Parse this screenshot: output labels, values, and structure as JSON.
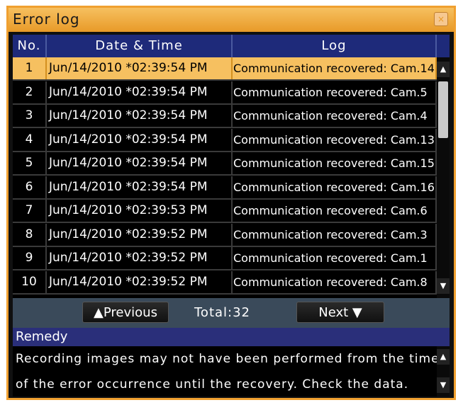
{
  "window": {
    "title": "Error log",
    "close_label": "×"
  },
  "table": {
    "headers": [
      "No.",
      "Date & Time",
      "Log"
    ],
    "rows": [
      {
        "no": "1",
        "datetime": "Jun/14/2010  *02:39:54 PM",
        "log": "Communication recovered: Cam.14",
        "selected": true
      },
      {
        "no": "2",
        "datetime": "Jun/14/2010  *02:39:54 PM",
        "log": "Communication recovered: Cam.5"
      },
      {
        "no": "3",
        "datetime": "Jun/14/2010  *02:39:54 PM",
        "log": "Communication recovered: Cam.4"
      },
      {
        "no": "4",
        "datetime": "Jun/14/2010  *02:39:54 PM",
        "log": "Communication recovered: Cam.13"
      },
      {
        "no": "5",
        "datetime": "Jun/14/2010  *02:39:54 PM",
        "log": "Communication recovered: Cam.15"
      },
      {
        "no": "6",
        "datetime": "Jun/14/2010  *02:39:54 PM",
        "log": "Communication recovered: Cam.16"
      },
      {
        "no": "7",
        "datetime": "Jun/14/2010  *02:39:53 PM",
        "log": "Communication recovered: Cam.6"
      },
      {
        "no": "8",
        "datetime": "Jun/14/2010  *02:39:52 PM",
        "log": "Communication recovered: Cam.3"
      },
      {
        "no": "9",
        "datetime": "Jun/14/2010  *02:39:52 PM",
        "log": "Communication recovered: Cam.1"
      },
      {
        "no": "10",
        "datetime": "Jun/14/2010  *02:39:52 PM",
        "log": "Communication recovered: Cam.8"
      }
    ],
    "scroll_up_icon": "▲",
    "scroll_down_icon": "▼"
  },
  "pager": {
    "previous_label": "▲Previous",
    "total_label": "Total:32",
    "next_label": "Next ▼"
  },
  "remedy": {
    "heading": "Remedy",
    "line1": "Recording images may not have been performed from the time",
    "line2": "of the error occurrence until the recovery. Check the data."
  },
  "colors": {
    "accent": "#f0a030",
    "header": "#1e2a7a",
    "selected": "#f6c060"
  }
}
